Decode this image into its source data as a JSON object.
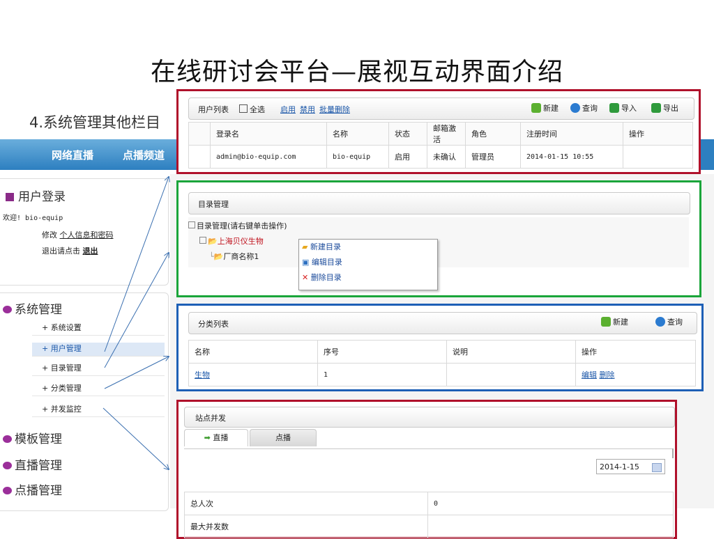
{
  "slide": {
    "title": "在线研讨会平台—展视互动界面介绍",
    "subtitle": "4.系统管理其他栏目"
  },
  "nav": {
    "items": [
      "网络直播",
      "点播频道"
    ]
  },
  "sidebar": {
    "login_title": "用户登录",
    "welcome": "欢迎! bio-equip",
    "modify_prefix": "修改",
    "modify_link": "个人信息和密码",
    "logout_prefix": "退出请点击",
    "logout_link": "退出",
    "sys_title": "系统管理",
    "menu": [
      "+ 系统设置",
      "+ 用户管理",
      "+ 目录管理",
      "+ 分类管理",
      "+ 并发监控"
    ],
    "other_sections": [
      "模板管理",
      "直播管理",
      "点播管理"
    ]
  },
  "users": {
    "list_label": "用户列表",
    "select_all": "全选",
    "enable": "启用",
    "disable": "禁用",
    "batch_delete": "批量删除",
    "new": "新建",
    "query": "查询",
    "import": "导入",
    "export": "导出",
    "columns": [
      "登录名",
      "名称",
      "状态",
      "邮箱激活",
      "角色",
      "注册时间",
      "操作"
    ],
    "rows": [
      [
        "admin@bio-equip.com",
        "bio-equip",
        "启用",
        "未确认",
        "管理员",
        "2014-01-15 10:55",
        ""
      ]
    ]
  },
  "catalog": {
    "title": "目录管理",
    "root": "目录管理(请右键单击操作)",
    "node": "上海贝仪生物",
    "child": "厂商名称1",
    "context_menu": [
      "新建目录",
      "编辑目录",
      "删除目录"
    ]
  },
  "category": {
    "title": "分类列表",
    "new": "新建",
    "query": "查询",
    "columns": [
      "名称",
      "序号",
      "说明",
      "操作"
    ],
    "rows": [
      {
        "name": "生物",
        "order": "1",
        "desc": "",
        "edit": "编辑",
        "delete": "删除"
      }
    ]
  },
  "concurrency": {
    "title": "站点并发",
    "tabs": [
      "直播",
      "点播"
    ],
    "date": "2014-1-15",
    "rows": [
      [
        "总人次",
        "0"
      ],
      [
        "最大并发数",
        ""
      ]
    ]
  },
  "colors": {
    "red_frame": "#b0112b",
    "green_frame": "#1aa53a",
    "blue_frame": "#1d5fb6",
    "nav_blue": "#2d7fc0",
    "link": "#1a56a8"
  }
}
